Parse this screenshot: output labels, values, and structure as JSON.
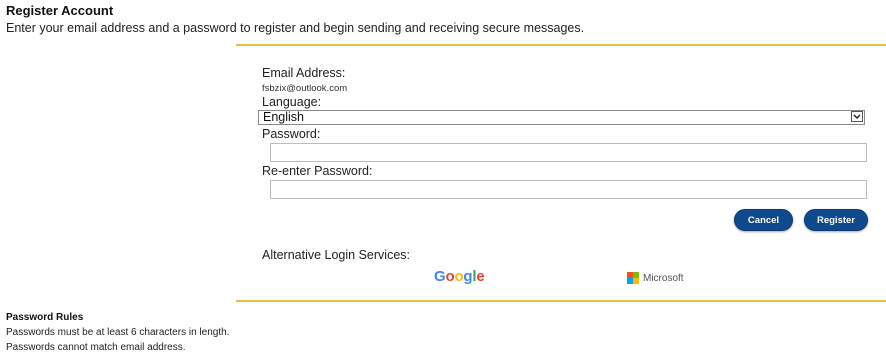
{
  "header": {
    "title": "Register Account",
    "intro": "Enter your email address and a password to register and begin sending and receiving secure messages."
  },
  "form": {
    "email_label": "Email Address:",
    "email_value": "fsbzix@outlook.com",
    "language_label": "Language:",
    "language_selected": "English",
    "password_label": "Password:",
    "password_value": "",
    "reenter_label": "Re-enter Password:",
    "reenter_value": ""
  },
  "buttons": {
    "cancel": "Cancel",
    "register": "Register"
  },
  "alt_login": {
    "label": "Alternative Login Services:",
    "google": [
      "G",
      "o",
      "o",
      "g",
      "l",
      "e"
    ],
    "microsoft": "Microsoft"
  },
  "rules": {
    "title": "Password Rules",
    "items": [
      "Passwords must be at least 6 characters in length.",
      "Passwords cannot match email address."
    ]
  },
  "colors": {
    "accent_rule": "#f1bf3e",
    "button": "#0e4a8c",
    "google": [
      "#4285F4",
      "#EA4335",
      "#FBBC05",
      "#4285F4",
      "#34A853",
      "#EA4335"
    ],
    "microsoft": [
      "#F25022",
      "#7FBA00",
      "#00A4EF",
      "#FFB900"
    ]
  },
  "icons": {
    "language_select": "chevron-down-icon",
    "microsoft_logo": "microsoft-logo-icon"
  }
}
